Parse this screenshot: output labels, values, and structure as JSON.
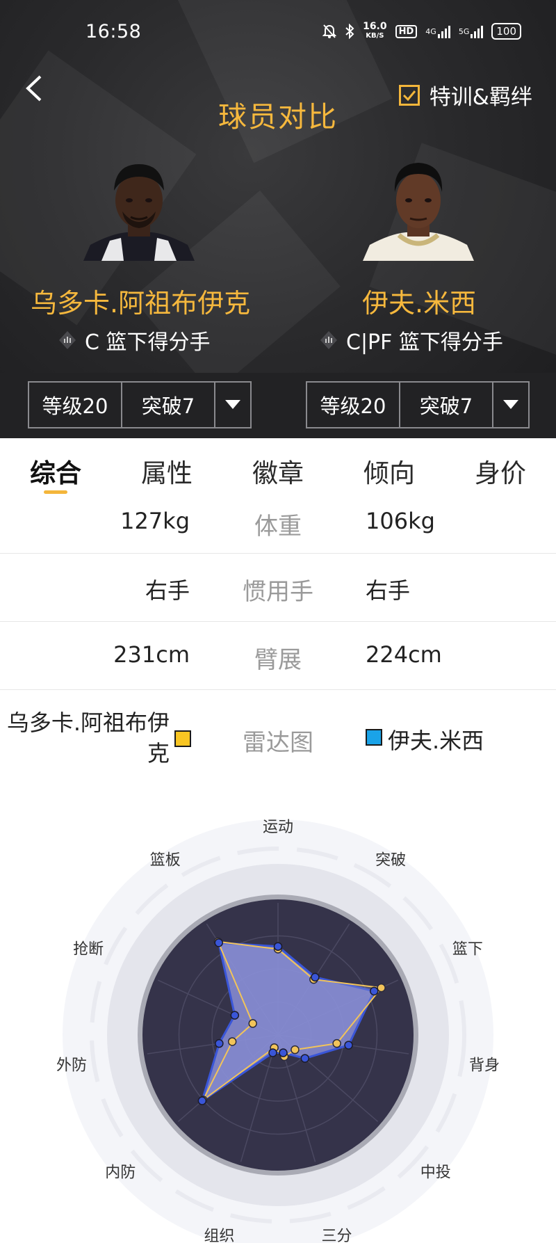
{
  "status_bar": {
    "time": "16:58",
    "net_speed_top": "16.0",
    "net_speed_unit": "KB/S",
    "hd_label": "HD",
    "net_4g": "4G",
    "net_5g": "5G",
    "battery": "100"
  },
  "header": {
    "title": "球员对比",
    "training_label": "特训&羁绊",
    "training_checked": true
  },
  "players": [
    {
      "name": "乌多卡.阿祖布伊克",
      "position": "C 篮下得分手",
      "level": "等级20",
      "breakthrough": "突破7"
    },
    {
      "name": "伊夫.米西",
      "position": "C|PF 篮下得分手",
      "level": "等级20",
      "breakthrough": "突破7"
    }
  ],
  "tabs": [
    {
      "label": "综合",
      "active": true
    },
    {
      "label": "属性",
      "active": false
    },
    {
      "label": "徽章",
      "active": false
    },
    {
      "label": "倾向",
      "active": false
    },
    {
      "label": "身价",
      "active": false
    }
  ],
  "compare_rows": [
    {
      "label": "体重",
      "left": "127kg",
      "right": "106kg"
    },
    {
      "label": "惯用手",
      "left": "右手",
      "right": "右手"
    },
    {
      "label": "臂展",
      "left": "231cm",
      "right": "224cm"
    }
  ],
  "radar_legend": {
    "title": "雷达图",
    "left_name": "乌多卡.阿祖布伊克",
    "right_name": "伊夫.米西",
    "left_color": "#f9c623",
    "right_color": "#1aa3e8"
  },
  "colors": {
    "accent": "#f6b83d",
    "header_bg": "#2a2a2c",
    "radar_fill": "#8a8fd8",
    "radar_outline_blue": "#3a56d8",
    "radar_outline_yellow": "#f2c45a"
  },
  "chart_data": {
    "type": "radar",
    "axes": [
      "运动",
      "突破",
      "篮下",
      "背身",
      "中投",
      "三分",
      "组织",
      "内防",
      "外防",
      "抢断",
      "篮板"
    ],
    "max": 1.0,
    "series": [
      {
        "name": "乌多卡.阿祖布伊克",
        "values": [
          0.65,
          0.5,
          0.86,
          0.45,
          0.17,
          0.17,
          0.1,
          0.75,
          0.35,
          0.21,
          0.84
        ]
      },
      {
        "name": "伊夫.米西",
        "values": [
          0.67,
          0.52,
          0.8,
          0.54,
          0.27,
          0.14,
          0.14,
          0.76,
          0.45,
          0.36,
          0.83
        ]
      }
    ]
  }
}
